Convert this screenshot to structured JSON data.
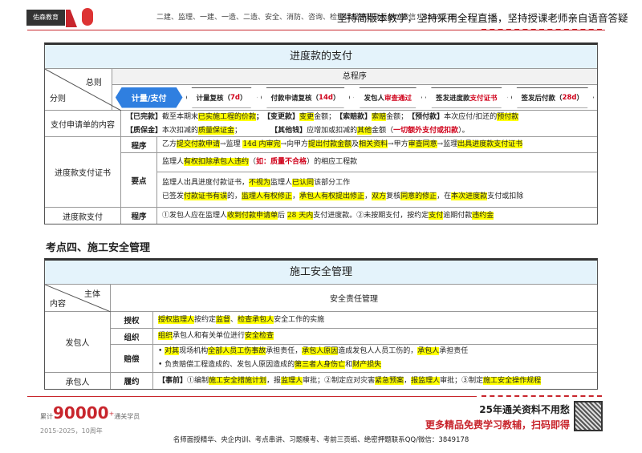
{
  "header": {
    "logo": "佑森教育",
    "left_text": "二建、监理、一建、一造、二造、安全、消防、咨询、检测课程押题联系QQ/微信：3849178",
    "right_text": "坚持简版本教学，坚持采用全程直播，坚持授课老师亲自语音答疑"
  },
  "table1": {
    "title": "进度款的支付",
    "corner_top": "总则",
    "corner_bottom": "分则",
    "general_header": "总程序",
    "steps": [
      [
        {
          "t": "计量/支付",
          "s": ""
        }
      ],
      [
        {
          "t": "计量复核（",
          "s": ""
        },
        {
          "t": "7d",
          "s": "r"
        },
        {
          "t": "）",
          "s": ""
        }
      ],
      [
        {
          "t": "付款申请复核（",
          "s": ""
        },
        {
          "t": "14d",
          "s": "r"
        },
        {
          "t": "）",
          "s": ""
        }
      ],
      [
        {
          "t": "发包人",
          "s": ""
        },
        {
          "t": "审查通过",
          "s": "r"
        }
      ],
      [
        {
          "t": "签发进度款",
          "s": ""
        },
        {
          "t": "支付证书",
          "s": "r"
        }
      ],
      [
        {
          "t": "签发后付款（",
          "s": ""
        },
        {
          "t": "28d",
          "s": "r"
        },
        {
          "t": "）",
          "s": ""
        }
      ]
    ],
    "rows": [
      {
        "label": "支付申请单的内容",
        "lines": [
          [
            {
              "t": "【已完款】",
              "s": "b"
            },
            {
              "t": "截至本期末",
              "s": ""
            },
            {
              "t": "已实施工程的价款",
              "s": "h"
            },
            {
              "t": "；　【变更款】",
              "s": "b"
            },
            {
              "t": "变更",
              "s": "h"
            },
            {
              "t": "金额；　",
              "s": ""
            },
            {
              "t": "【索赔款】",
              "s": "b"
            },
            {
              "t": "索赔",
              "s": "h"
            },
            {
              "t": "金额；　",
              "s": ""
            },
            {
              "t": "【预付款】",
              "s": "b"
            },
            {
              "t": "本次应付/扣还的",
              "s": ""
            },
            {
              "t": "预付款",
              "s": "h"
            }
          ],
          [
            {
              "t": "【质保金】",
              "s": "b"
            },
            {
              "t": "本次扣减的",
              "s": ""
            },
            {
              "t": "质量保证金",
              "s": "h"
            },
            {
              "t": "；　　　　　",
              "s": ""
            },
            {
              "t": "【其他钱】",
              "s": "b"
            },
            {
              "t": "应增加或扣减的",
              "s": ""
            },
            {
              "t": "其他",
              "s": "h"
            },
            {
              "t": "金额（",
              "s": ""
            },
            {
              "t": "一切额外支付或扣款",
              "s": "r"
            },
            {
              "t": "）。",
              "s": ""
            }
          ]
        ]
      },
      {
        "label": "进度款支付证书",
        "subs": [
          {
            "key": "程序",
            "lines": [
              [
                {
                  "t": "乙方",
                  "s": ""
                },
                {
                  "t": "提交付款申请",
                  "s": "h"
                },
                {
                  "t": "→监理 ",
                  "s": ""
                },
                {
                  "t": "14d 内审完",
                  "s": "h"
                },
                {
                  "t": "→向甲方",
                  "s": ""
                },
                {
                  "t": "提出付款金额",
                  "s": "h"
                },
                {
                  "t": "及",
                  "s": ""
                },
                {
                  "t": "相关资料",
                  "s": "h"
                },
                {
                  "t": "→甲方",
                  "s": ""
                },
                {
                  "t": "审查同意",
                  "s": "h"
                },
                {
                  "t": "→监理",
                  "s": ""
                },
                {
                  "t": "出具进度款支付证书",
                  "s": "h"
                }
              ]
            ]
          },
          {
            "key": "要点",
            "parts": [
              [
                [
                  {
                    "t": "监理人",
                    "s": ""
                  },
                  {
                    "t": "有权扣除承包人违约",
                    "s": "h"
                  },
                  {
                    "t": "（",
                    "s": ""
                  },
                  {
                    "t": "如：质量不合格",
                    "s": "r"
                  },
                  {
                    "t": "）的相应工程款",
                    "s": ""
                  }
                ]
              ],
              [
                [
                  {
                    "t": "监理人出具进度付款证书，",
                    "s": ""
                  },
                  {
                    "t": "不视为",
                    "s": "h"
                  },
                  {
                    "t": "监理人",
                    "s": ""
                  },
                  {
                    "t": "已认同",
                    "s": "h"
                  },
                  {
                    "t": "该部分工作",
                    "s": ""
                  }
                ],
                [
                  {
                    "t": "已签发",
                    "s": ""
                  },
                  {
                    "t": "付款证书有误",
                    "s": "h"
                  },
                  {
                    "t": "的，",
                    "s": ""
                  },
                  {
                    "t": "监理人有权修正",
                    "s": "h"
                  },
                  {
                    "t": "，",
                    "s": ""
                  },
                  {
                    "t": "承包人有权提出修正",
                    "s": "h"
                  },
                  {
                    "t": "，",
                    "s": ""
                  },
                  {
                    "t": "双方",
                    "s": "h"
                  },
                  {
                    "t": "复核",
                    "s": ""
                  },
                  {
                    "t": "同意的修正",
                    "s": "h"
                  },
                  {
                    "t": "，在",
                    "s": ""
                  },
                  {
                    "t": "本次进度款",
                    "s": "h"
                  },
                  {
                    "t": "支付或扣除",
                    "s": ""
                  }
                ]
              ]
            ]
          }
        ]
      },
      {
        "label": "进度款支付",
        "key": "程序",
        "lines": [
          [
            {
              "t": "①发包人应在监理人",
              "s": ""
            },
            {
              "t": "收到付款申请单",
              "s": "h"
            },
            {
              "t": "后 ",
              "s": ""
            },
            {
              "t": "28 天内",
              "s": "h"
            },
            {
              "t": "支付进度款。②未按期支付，按约定",
              "s": ""
            },
            {
              "t": "支付",
              "s": "h"
            },
            {
              "t": "逾期付款",
              "s": ""
            },
            {
              "t": "违约金",
              "s": "h"
            }
          ]
        ]
      }
    ]
  },
  "section_heading": "考点四、施工安全管理",
  "table2": {
    "title": "施工安全管理",
    "corner_top": "主体",
    "corner_bottom": "内容",
    "header": "安全责任管理",
    "owner": "发包人",
    "contractor": "承包人",
    "rows": [
      {
        "key": "授权",
        "lines": [
          [
            {
              "t": "授权监理人",
              "s": "h"
            },
            {
              "t": "按约定",
              "s": ""
            },
            {
              "t": "监督",
              "s": "h"
            },
            {
              "t": "、",
              "s": ""
            },
            {
              "t": "检查承包人",
              "s": "h"
            },
            {
              "t": "安全工作的实施",
              "s": ""
            }
          ]
        ]
      },
      {
        "key": "组织",
        "lines": [
          [
            {
              "t": "组织",
              "s": "h"
            },
            {
              "t": "承包人和有关单位进行",
              "s": ""
            },
            {
              "t": "安全检查",
              "s": "h"
            }
          ]
        ]
      },
      {
        "key": "赔偿",
        "lines": [
          [
            {
              "t": "• ",
              "s": ""
            },
            {
              "t": "对其",
              "s": "h"
            },
            {
              "t": "现场机构",
              "s": ""
            },
            {
              "t": "全部人员工伤事故",
              "s": "h"
            },
            {
              "t": "承担责任，",
              "s": ""
            },
            {
              "t": "承包人原因",
              "s": "h"
            },
            {
              "t": "造成发包人人员工伤的，",
              "s": ""
            },
            {
              "t": "承包人",
              "s": "h"
            },
            {
              "t": "承担责任",
              "s": ""
            }
          ],
          [
            {
              "t": "• 负责赔偿工程造成的、发包人原因造成的",
              "s": ""
            },
            {
              "t": "第三者人身伤亡",
              "s": "h"
            },
            {
              "t": "和",
              "s": ""
            },
            {
              "t": "财产损失",
              "s": "h"
            }
          ]
        ]
      },
      {
        "key": "履约",
        "lines": [
          [
            {
              "t": "【事前】",
              "s": "b"
            },
            {
              "t": "①编制",
              "s": ""
            },
            {
              "t": "施工安全措施计划",
              "s": "h"
            },
            {
              "t": "，报",
              "s": ""
            },
            {
              "t": "监理人",
              "s": "h"
            },
            {
              "t": "审批；②制定应对灾害",
              "s": ""
            },
            {
              "t": "紧急预案",
              "s": "h"
            },
            {
              "t": "，",
              "s": ""
            },
            {
              "t": "报监理人",
              "s": "h"
            },
            {
              "t": "审批；③制定",
              "s": ""
            },
            {
              "t": "施工安全操作规程",
              "s": "h"
            }
          ]
        ]
      }
    ]
  },
  "footer": {
    "count_prefix": "累计",
    "count": "90000",
    "count_sup": "+",
    "count_suffix": "通关学员",
    "years": "2015-2025，10周年",
    "ad1": "25年通关资料不用愁",
    "ad2": "更多精品免费学习教辅，扫码即得",
    "bottom": "名师面授精华、央企内训、考点串讲、习题模考、考前三页纸、绝密押题联系QQ/微信：3849178"
  },
  "colors": {
    "highlight": "#ffff00",
    "accent_red": "#c8252c",
    "step_blue": "#2f7fe0",
    "title_bg": "#e4f3fb"
  }
}
